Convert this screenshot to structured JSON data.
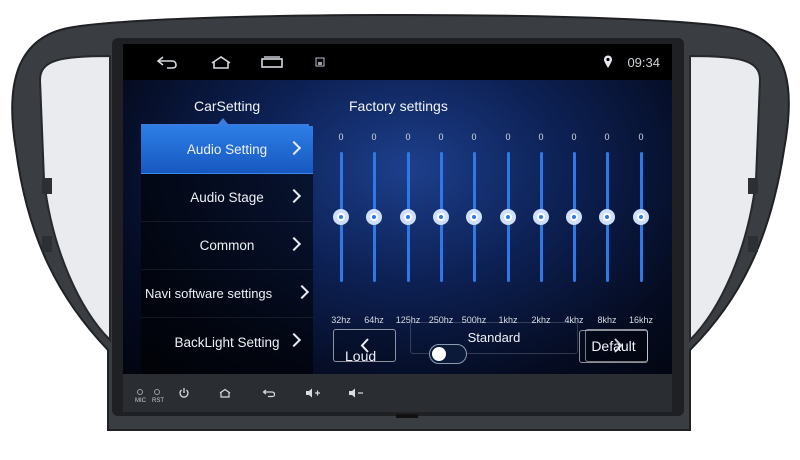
{
  "status_bar": {
    "time": "09:34",
    "icons": [
      "back-arrow-icon",
      "home-icon",
      "recent-apps-icon",
      "notification-icon",
      "location-pin-icon"
    ]
  },
  "tabs": [
    {
      "label": "CarSetting",
      "active": true
    },
    {
      "label": "Factory settings",
      "active": false
    }
  ],
  "sidebar": {
    "items": [
      {
        "label": "Audio Setting",
        "active": true
      },
      {
        "label": "Audio Stage",
        "active": false
      },
      {
        "label": "Common",
        "active": false
      },
      {
        "label": "Navi software settings",
        "active": false
      },
      {
        "label": "BackLight Setting",
        "active": false
      }
    ]
  },
  "equalizer": {
    "bands": [
      {
        "freq": "32hz",
        "value": "0",
        "level": 0.5
      },
      {
        "freq": "64hz",
        "value": "0",
        "level": 0.5
      },
      {
        "freq": "125hz",
        "value": "0",
        "level": 0.5
      },
      {
        "freq": "250hz",
        "value": "0",
        "level": 0.5
      },
      {
        "freq": "500hz",
        "value": "0",
        "level": 0.5
      },
      {
        "freq": "1khz",
        "value": "0",
        "level": 0.5
      },
      {
        "freq": "2khz",
        "value": "0",
        "level": 0.5
      },
      {
        "freq": "4khz",
        "value": "0",
        "level": 0.5
      },
      {
        "freq": "8khz",
        "value": "0",
        "level": 0.5
      },
      {
        "freq": "16khz",
        "value": "0",
        "level": 0.5
      }
    ],
    "preset": "Standard"
  },
  "loud": {
    "label": "Loud",
    "enabled": false
  },
  "default_button": "Default",
  "hardware_bar": {
    "labels": [
      "MIC",
      "RST"
    ],
    "icons": [
      "power-icon",
      "home-icon",
      "back-icon",
      "volume-up-icon",
      "volume-down-icon"
    ]
  },
  "colors": {
    "accent": "#2f79e6",
    "active_item": "#1f6ad6",
    "bezel": "#2c2f33"
  }
}
